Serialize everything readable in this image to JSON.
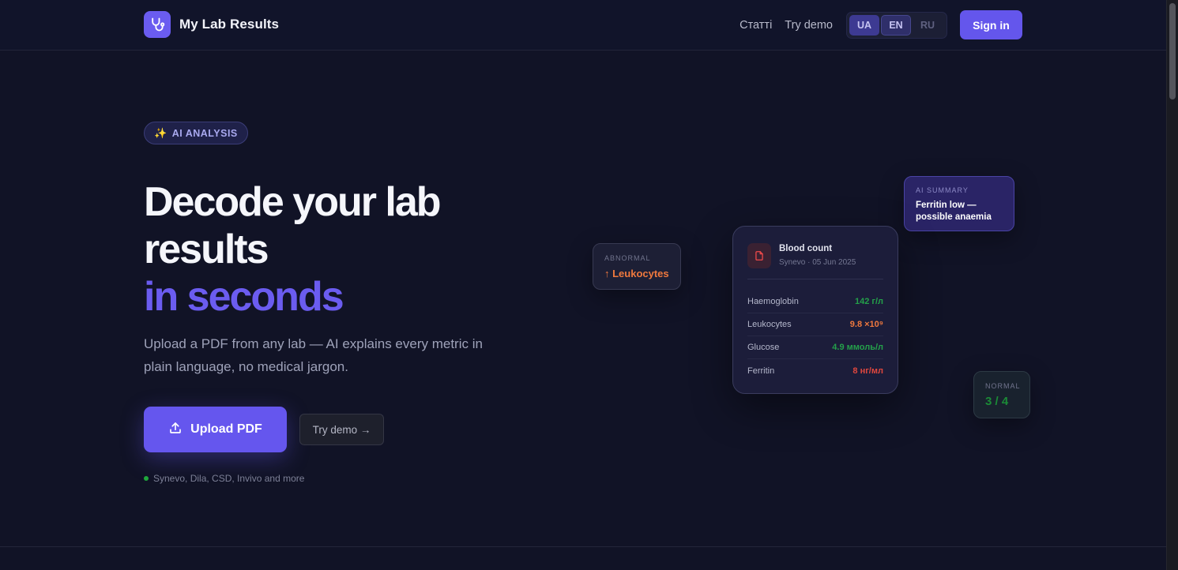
{
  "header": {
    "title": "My Lab Results",
    "nav": {
      "articles": "Статті",
      "demo": "Try demo"
    },
    "languages": [
      {
        "code": "UA",
        "state": "active"
      },
      {
        "code": "EN",
        "state": "selected"
      },
      {
        "code": "RU",
        "state": "inactive"
      }
    ],
    "signin": "Sign in"
  },
  "hero": {
    "badge_icon": "✨",
    "badge": "AI ANALYSIS",
    "title_line1": "Decode your lab results",
    "title_accent": "in seconds",
    "subtitle": "Upload a PDF from any lab — AI explains every metric in plain language, no medical jargon.",
    "upload_label": "Upload PDF",
    "demo_label": "Try demo →",
    "labs_note": "Synevo, Dila, CSD, Invivo and more"
  },
  "chips": {
    "abnormal_label": "ABNORMAL",
    "abnormal_value": "↑ Leukocytes",
    "summary_label": "AI SUMMARY",
    "summary_value": "Ferritin low — possible anaemia",
    "normal_label": "NORMAL",
    "normal_value": "3 / 4"
  },
  "card": {
    "title": "Blood count",
    "subtitle": "Synevo · 05 Jun 2025",
    "rows": [
      {
        "name": "Haemoglobin",
        "value": "142 г/л",
        "color": "#24a04a"
      },
      {
        "name": "Leukocytes",
        "value": "9.8 ×10⁹",
        "color": "#f0793e"
      },
      {
        "name": "Glucose",
        "value": "4.9 ммоль/л",
        "color": "#24a04a"
      },
      {
        "name": "Ferritin",
        "value": "8 нг/мл",
        "color": "#e0473e"
      }
    ]
  },
  "colors": {
    "accent": "#6556ee",
    "ok": "#24a04a",
    "warn": "#f0793e",
    "bad": "#e0473e"
  }
}
